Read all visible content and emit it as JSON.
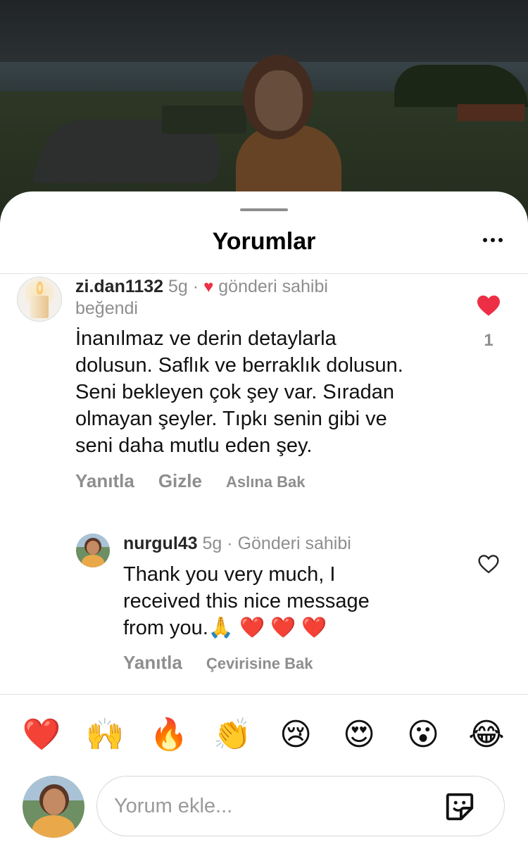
{
  "sheet": {
    "title": "Yorumlar"
  },
  "comments": [
    {
      "username": "zi.dan1132",
      "time": "5g",
      "separator": "·",
      "liked_by_author_label_1": "gönderi sahibi",
      "liked_by_author_label_2": "beğendi",
      "text_lines": [
        "İnanılmaz ve derin detaylarla",
        "dolusun. Saflık ve berraklık dolusun.",
        "Seni bekleyen çok şey var. Sıradan",
        "olmayan şeyler. Tıpkı senin gibi ve",
        "seni daha mutlu eden şey."
      ],
      "reply_label": "Yanıtla",
      "hide_label": "Gizle",
      "original_label": "Aslına Bak",
      "like_count": "1",
      "liked": true
    },
    {
      "username": "nurgul43",
      "time": "5g",
      "separator": "·",
      "author_badge": "Gönderi sahibi",
      "text_lines": [
        "Thank you very much, I",
        "received this nice message",
        "from you.🙏 ❤️ ❤️ ❤️"
      ],
      "reply_label": "Yanıtla",
      "translate_label": "Çevirisine Bak",
      "liked": false
    }
  ],
  "reactions": [
    "❤️",
    "🙌",
    "🔥",
    "👏",
    "😢",
    "😍",
    "😮",
    "😂"
  ],
  "composer": {
    "placeholder": "Yorum ekle..."
  },
  "colors": {
    "like_red": "#ed2f45",
    "muted": "#8e8e8e"
  },
  "icons": [
    "more-icon",
    "heart-filled-icon",
    "heart-outline-icon",
    "sticker-icon"
  ]
}
